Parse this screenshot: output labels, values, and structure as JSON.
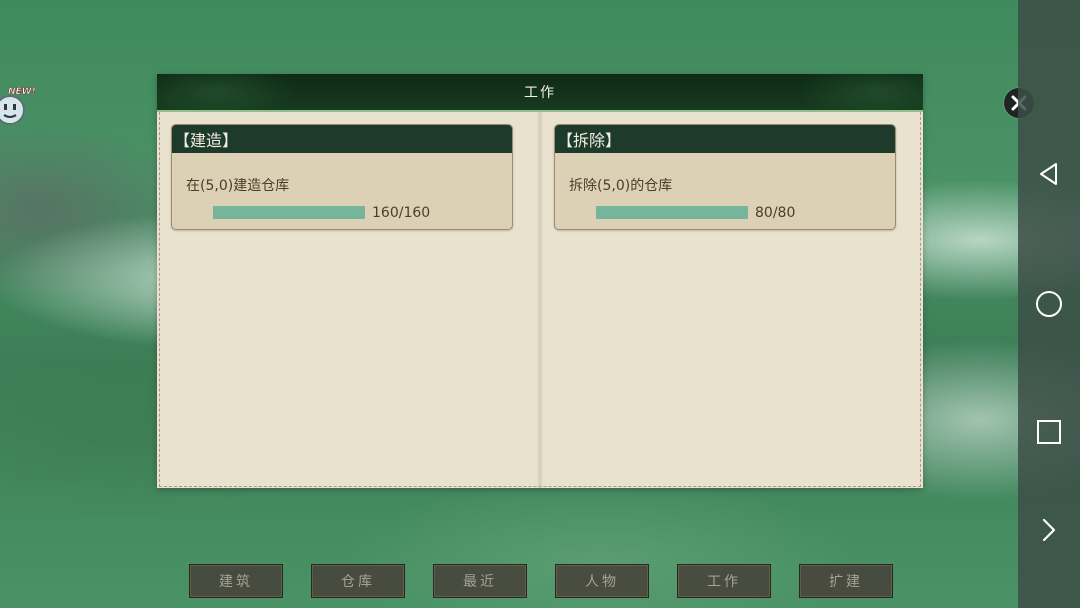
{
  "badge": {
    "text": "NEW!"
  },
  "dialog": {
    "title": "工作",
    "jobs": [
      {
        "title": "【建造】",
        "description": "在(5,0)建造仓库",
        "progress_text": "160/160",
        "progress": 1.0
      },
      {
        "title": "【拆除】",
        "description": "拆除(5,0)的仓库",
        "progress_text": "80/80",
        "progress": 1.0
      }
    ]
  },
  "tabs": [
    {
      "label": "建筑"
    },
    {
      "label": "仓库"
    },
    {
      "label": "最近"
    },
    {
      "label": "人物"
    },
    {
      "label": "工作"
    },
    {
      "label": "扩建"
    }
  ],
  "navbar": {
    "icons": [
      "back-icon",
      "home-icon",
      "recents-icon",
      "chevron-right-icon"
    ]
  },
  "colors": {
    "header": "#173a1f",
    "card_header": "#1e3a2a",
    "progress_fill": "#76b49b",
    "paper": "#e9e2cf"
  }
}
